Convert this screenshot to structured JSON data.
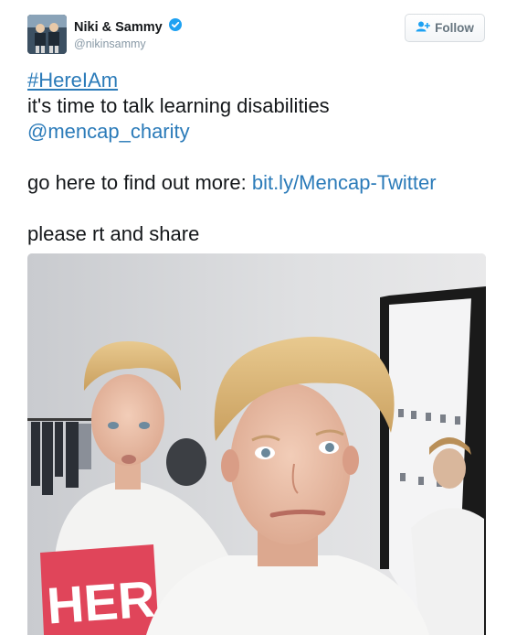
{
  "user": {
    "display_name": "Niki & Sammy",
    "handle": "@nikinsammy",
    "verified": true
  },
  "follow_button": {
    "label": "Follow",
    "icon": "add-user-icon"
  },
  "tweet": {
    "hashtag": "#HereIAm",
    "line1": "it's time to talk learning disabilities",
    "mention": "@mencap_charity",
    "line3_prefix": "go here to find out more: ",
    "link": "bit.ly/Mencap-Twitter",
    "line4": "please rt and share"
  },
  "media": {
    "shirt_text": "HER"
  },
  "colors": {
    "link": "#2b7bb9",
    "verified": "#1da1f2",
    "shirt_print": "#e0455a"
  }
}
